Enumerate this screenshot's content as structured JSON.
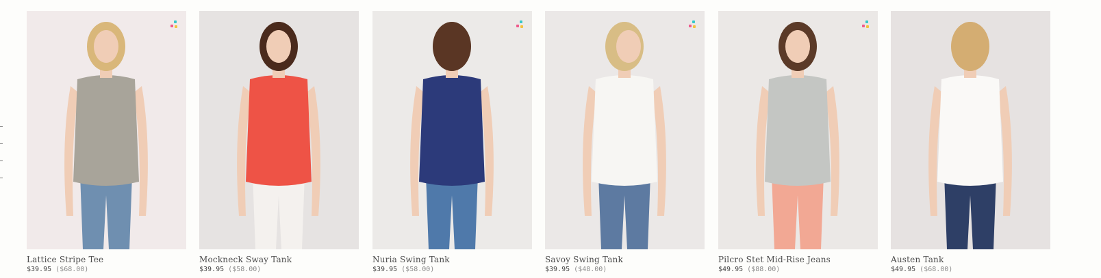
{
  "products": [
    {
      "name": "Lattice Stripe Tee",
      "sale_price": "$39.95",
      "original_price": "($68.00)",
      "has_badge": true,
      "top_color": "#a8a49a",
      "bottom_color": "#6f8fb0",
      "hair_color": "#d9b77a",
      "bg_color": "#f1eaea",
      "view": "front"
    },
    {
      "name": "Mockneck Sway Tank",
      "sale_price": "$39.95",
      "original_price": "($58.00)",
      "has_badge": false,
      "top_color": "#ee5346",
      "bottom_color": "#f4f1ee",
      "hair_color": "#4a2a1c",
      "bg_color": "#e6e3e2",
      "view": "front"
    },
    {
      "name": "Nuria Swing Tank",
      "sale_price": "$39.95",
      "original_price": "($58.00)",
      "has_badge": true,
      "top_color": "#2c3a7a",
      "bottom_color": "#4f79aa",
      "hair_color": "#5a3624",
      "bg_color": "#eceae8",
      "view": "back"
    },
    {
      "name": "Savoy Swing Tank",
      "sale_price": "$39.95",
      "original_price": "($48.00)",
      "has_badge": true,
      "top_color": "#f7f6f3",
      "bottom_color": "#5d7aa1",
      "hair_color": "#d8bd85",
      "bg_color": "#ebe8e7",
      "view": "side"
    },
    {
      "name": "Pilcro Stet Mid-Rise Jeans",
      "sale_price": "$49.95",
      "original_price": "($88.00)",
      "has_badge": true,
      "top_color": "#c4c6c3",
      "bottom_color": "#f2a894",
      "hair_color": "#5b3a28",
      "bg_color": "#ebe8e6",
      "view": "front"
    },
    {
      "name": "Austen Tank",
      "sale_price": "$49.95",
      "original_price": "($68.00)",
      "has_badge": false,
      "top_color": "#faf9f7",
      "bottom_color": "#2e3f66",
      "hair_color": "#d4ad72",
      "bg_color": "#e6e2e1",
      "view": "back"
    }
  ],
  "badge_colors": [
    "#ef5a8c",
    "#34c7c9",
    "#f2c240"
  ]
}
